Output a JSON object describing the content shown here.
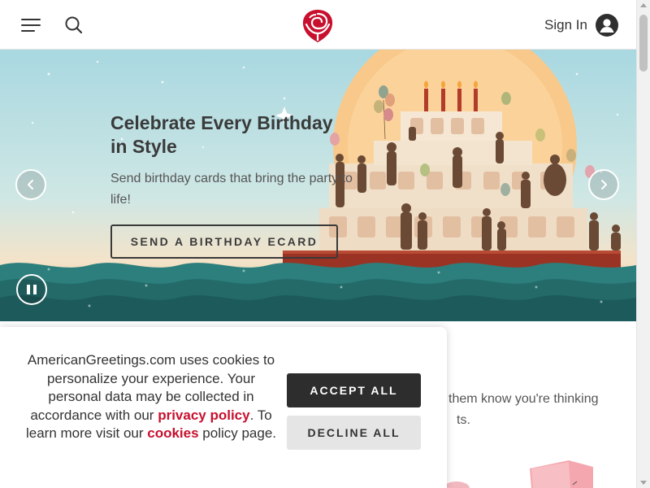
{
  "header": {
    "menu_icon": "hamburger-menu-icon",
    "search_icon": "search-icon",
    "logo_icon": "rose-logo-icon",
    "signin_label": "Sign In",
    "account_icon": "user-account-icon",
    "brand_color": "#c8102e"
  },
  "hero": {
    "title": "Celebrate Every Birthday in Style",
    "subtitle": "Send birthday cards that bring the party to life!",
    "cta_label": "SEND A BIRTHDAY ECARD",
    "prev_icon": "chevron-left-icon",
    "next_icon": "chevron-right-icon",
    "pause_icon": "pause-icon"
  },
  "content": {
    "line1": "them know you're thinking",
    "line2": "ts."
  },
  "cookie_banner": {
    "text_before_privacy": "AmericanGreetings.com uses cookies to personalize your experience. Your personal data may be collected in accordance with our ",
    "privacy_link": "privacy policy",
    "text_middle": ". To learn more visit our ",
    "cookies_link": "cookies",
    "text_after": " policy page.",
    "accept_label": "ACCEPT ALL",
    "decline_label": "DECLINE ALL"
  }
}
